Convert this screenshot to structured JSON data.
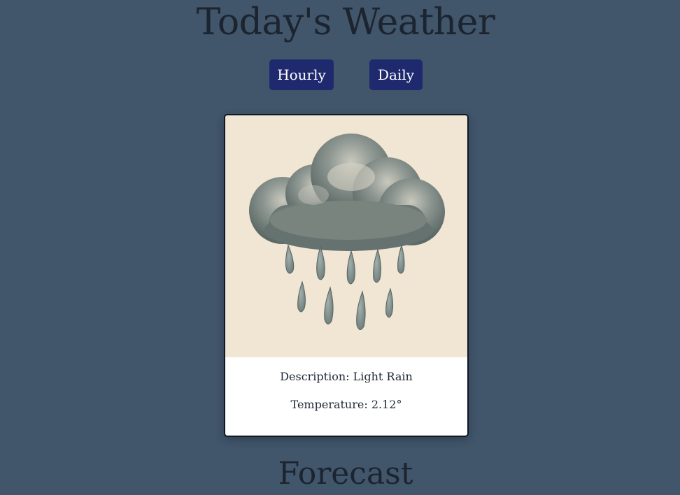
{
  "header": {
    "title": "Today's Weather"
  },
  "nav": {
    "hourly_label": "Hourly",
    "daily_label": "Daily"
  },
  "card": {
    "image_icon": "rain-cloud-icon",
    "description": "Description: Light Rain",
    "temperature": "Temperature: 2.12°"
  },
  "section": {
    "forecast_title": "Forecast"
  },
  "colors": {
    "background": "#41556b",
    "button": "#1f2a6e",
    "card_image_bg": "#f1e5d3"
  }
}
